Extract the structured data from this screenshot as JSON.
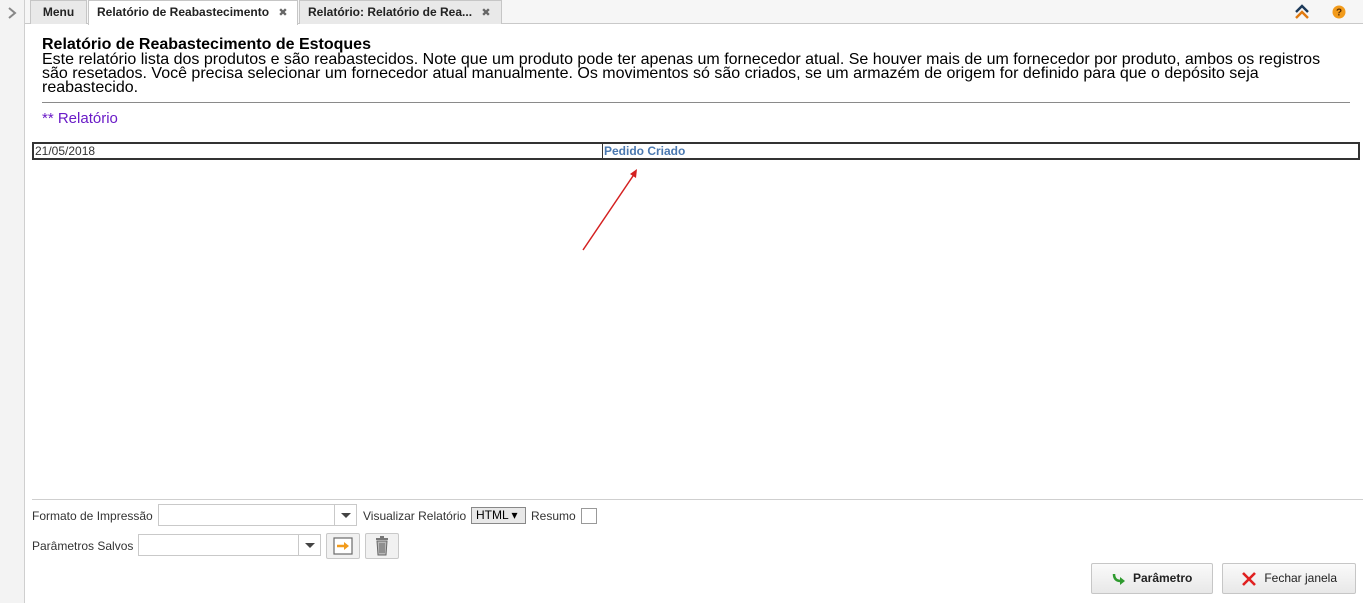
{
  "tabs": [
    {
      "label": "Menu",
      "active": false,
      "closable": false
    },
    {
      "label": "Relatório de Reabastecimento",
      "active": true,
      "closable": true
    },
    {
      "label": "Relatório: Relatório de Rea...",
      "active": false,
      "closable": true
    }
  ],
  "tab_close_glyph": "✖",
  "header": {
    "title": "Relatório de Reabastecimento de Estoques",
    "description_lines": [
      "Este relatório lista dos produtos e são reabastecidos. Note que um produto pode ter apenas um fornecedor atual. Se houver mais de um fornecedor por produto, ambos os registros",
      "são resetados. Você precisa selecionar um fornecedor atual manualmente. Os movimentos só são criados, se um armazém de origem for definido para que o depósito seja",
      "reabastecido."
    ]
  },
  "section_label": "** Relatório",
  "report": {
    "date": "21/05/2018",
    "status": "Pedido Criado"
  },
  "params": {
    "print_format_label": "Formato de Impressão",
    "print_format_value": "",
    "view_report_label": "Visualizar Relatório",
    "view_report_value": "HTML ▾",
    "summary_label": "Resumo",
    "saved_params_label": "Parâmetros Salvos",
    "saved_params_value": ""
  },
  "buttons": {
    "parameter": "Parâmetro",
    "close_window": "Fechar janela"
  },
  "colors": {
    "section_label": "#6a1bc7",
    "status_link": "#4a78b0",
    "annotation_arrow": "#d42020",
    "help_icon": "#f29b1b",
    "collapse_icon": "#e07a10"
  },
  "icons": {
    "sidebar_toggle": "chevron-right-icon",
    "collapse": "double-chevron-up-icon",
    "help": "help-icon",
    "load_params": "load-params-icon",
    "delete_params": "trash-icon",
    "parameter_button": "green-arrow-icon",
    "close_button": "red-x-icon"
  }
}
